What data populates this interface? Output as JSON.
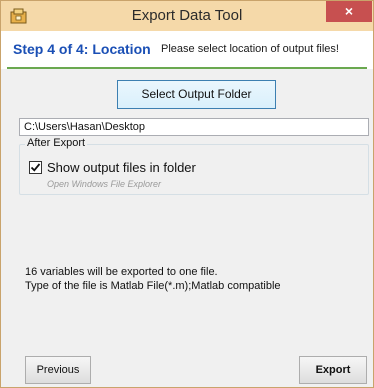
{
  "window": {
    "title": "Export Data Tool",
    "close_label": "×"
  },
  "header": {
    "step_title": "Step 4 of 4: Location",
    "description": "Please select location of output files!"
  },
  "location": {
    "select_folder_label": "Select Output Folder",
    "output_path": "C:\\Users\\Hasan\\Desktop"
  },
  "after_export": {
    "group_label": "After Export",
    "show_files_label": "Show output files in folder",
    "show_files_checked": true,
    "hint": "Open Windows File Explorer"
  },
  "summary": {
    "line1": "16 variables will be exported to one file.",
    "line2": "Type of the file is Matlab File(*.m);Matlab compatible"
  },
  "footer": {
    "previous_label": "Previous",
    "export_label": "Export"
  },
  "colors": {
    "titlebar": "#f5d9a9",
    "step_title": "#1a4fb5",
    "accent_line": "#6aa84f",
    "close_button": "#c75050"
  },
  "icons": {
    "app": "app-icon",
    "close": "close-icon",
    "check": "checkmark-icon"
  }
}
